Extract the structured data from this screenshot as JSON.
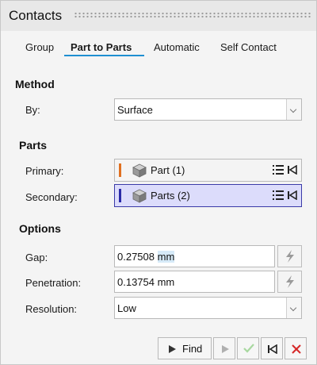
{
  "window": {
    "title": "Contacts"
  },
  "tabs": [
    {
      "label": "Group"
    },
    {
      "label": "Part to Parts"
    },
    {
      "label": "Automatic"
    },
    {
      "label": "Self Contact"
    }
  ],
  "active_tab": "Part to Parts",
  "method": {
    "heading": "Method",
    "by_label": "By:",
    "by_value": "Surface"
  },
  "parts": {
    "heading": "Parts",
    "primary_label": "Primary:",
    "primary_value": "Part (1)",
    "primary_color": "#e07020",
    "secondary_label": "Secondary:",
    "secondary_value": "Parts (2)",
    "secondary_color": "#2a2aa8"
  },
  "options": {
    "heading": "Options",
    "gap_label": "Gap:",
    "gap_number": "0.27508",
    "gap_unit": "mm",
    "penetration_label": "Penetration:",
    "penetration_value": "0.13754 mm",
    "resolution_label": "Resolution:",
    "resolution_value": "Low"
  },
  "footer": {
    "find_label": "Find"
  },
  "icons": {
    "find": "play-icon",
    "step": "step-forward-icon",
    "apply": "check-icon",
    "reset": "skip-back-icon",
    "close": "close-icon",
    "generate": "lightning-icon",
    "list": "list-icon",
    "part": "cube-icon"
  }
}
